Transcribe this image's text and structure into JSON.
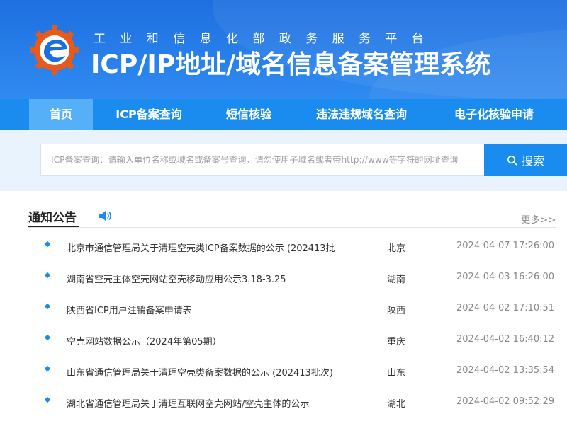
{
  "header": {
    "subtitle": "工业和信息化部政务服务平台",
    "title": "ICP/IP地址/域名信息备案管理系统",
    "colors": {
      "band": "#1e6fe0",
      "logo_gear": "#e85a1b",
      "logo_inner": "#1a6ee0"
    }
  },
  "nav": {
    "active_color": "#56b0f7",
    "bar_color": "#1a8cf0",
    "items": [
      {
        "label": "首页",
        "active": true
      },
      {
        "label": "ICP备案查询",
        "active": false
      },
      {
        "label": "短信核验",
        "active": false
      },
      {
        "label": "违法违规域名查询",
        "active": false
      },
      {
        "label": "电子化核验申请",
        "active": false
      }
    ]
  },
  "search": {
    "placeholder": "ICP备案查询：请输入单位名称或域名或备案号查询，请勿使用子域名或者带http://www等字符的网址查询",
    "button_label": "搜索",
    "icon": "search-icon"
  },
  "notices": {
    "title": "通知公告",
    "more_label": "更多>>",
    "icon": "speaker-icon",
    "items": [
      {
        "title": "北京市通信管理局关于清理空壳类ICP备案数据的公示 (202413批",
        "region": "北京",
        "date": "2024-04-07 17:26:00"
      },
      {
        "title": "湖南省空壳主体空壳网站空壳移动应用公示3.18-3.25",
        "region": "湖南",
        "date": "2024-04-03 16:26:00"
      },
      {
        "title": "陕西省ICP用户注销备案申请表",
        "region": "陕西",
        "date": "2024-04-02 17:10:51"
      },
      {
        "title": "空壳网站数据公示（2024年第05期）",
        "region": "重庆",
        "date": "2024-04-02 16:40:12"
      },
      {
        "title": "山东省通信管理局关于清理空壳类备案数据的公示 (202413批次)",
        "region": "山东",
        "date": "2024-04-02 13:35:54"
      },
      {
        "title": "湖北省通信管理局关于清理互联网空壳网站/空壳主体的公示",
        "region": "湖北",
        "date": "2024-04-02 09:52:29"
      }
    ]
  }
}
